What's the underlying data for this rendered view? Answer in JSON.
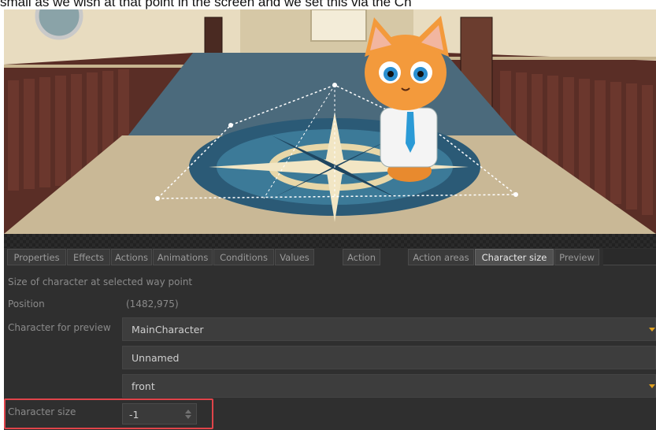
{
  "caption": {
    "text": "small as we wish at that point in the screen and we set this via the Ch"
  },
  "tabs": [
    {
      "label": "Properties",
      "active": false
    },
    {
      "label": "Effects",
      "active": false
    },
    {
      "label": "Actions",
      "active": false
    },
    {
      "label": "Animations",
      "active": false
    },
    {
      "label": "Conditions",
      "active": false
    },
    {
      "label": "Values",
      "active": false
    },
    {
      "label": "Action",
      "active": false
    },
    {
      "label": "Action areas",
      "active": false
    },
    {
      "label": "Character size",
      "active": true
    },
    {
      "label": "Preview",
      "active": false
    }
  ],
  "panel": {
    "description": "Size of character at selected way point",
    "position_label": "Position",
    "position_value": "(1482,975)",
    "character_preview_label": "Character for preview",
    "character_preview_value": "MainCharacter",
    "animation_value": "Unnamed",
    "direction_value": "front",
    "character_size_label": "Character size",
    "character_size_value": "-1"
  },
  "colors": {
    "accent_arrow": "#e0a020",
    "highlight_border": "#e0444a",
    "active_tab": "#505050"
  }
}
